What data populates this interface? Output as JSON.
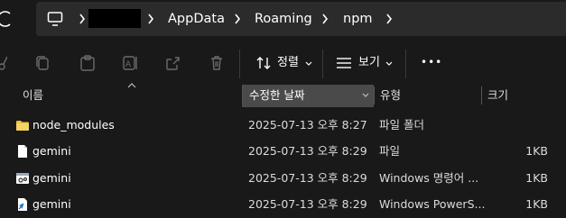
{
  "address_bar": {
    "breadcrumbs": [
      "AppData",
      "Roaming",
      "npm"
    ]
  },
  "toolbar": {
    "sort_label": "정렬",
    "view_label": "보기",
    "more_label": "•••"
  },
  "columns": {
    "name": "이름",
    "date_modified": "수정한 날짜",
    "type": "유형",
    "size": "크기"
  },
  "files": [
    {
      "name": "node_modules",
      "date": "2025-07-13 오후 8:27",
      "type": "파일 폴더",
      "size": "",
      "icon": "folder-icon"
    },
    {
      "name": "gemini",
      "date": "2025-07-13 오후 8:29",
      "type": "파일",
      "size": "1KB",
      "icon": "file-icon"
    },
    {
      "name": "gemini",
      "date": "2025-07-13 오후 8:29",
      "type": "Windows 명령어 ...",
      "size": "1KB",
      "icon": "cmd-script-icon"
    },
    {
      "name": "gemini",
      "date": "2025-07-13 오후 8:29",
      "type": "Windows PowerS...",
      "size": "1KB",
      "icon": "powershell-script-icon"
    }
  ],
  "colors": {
    "background": "#191919",
    "address_bar": "#2b2b2b",
    "folder": "#f0c040",
    "header_active": "#4a4a4a"
  }
}
